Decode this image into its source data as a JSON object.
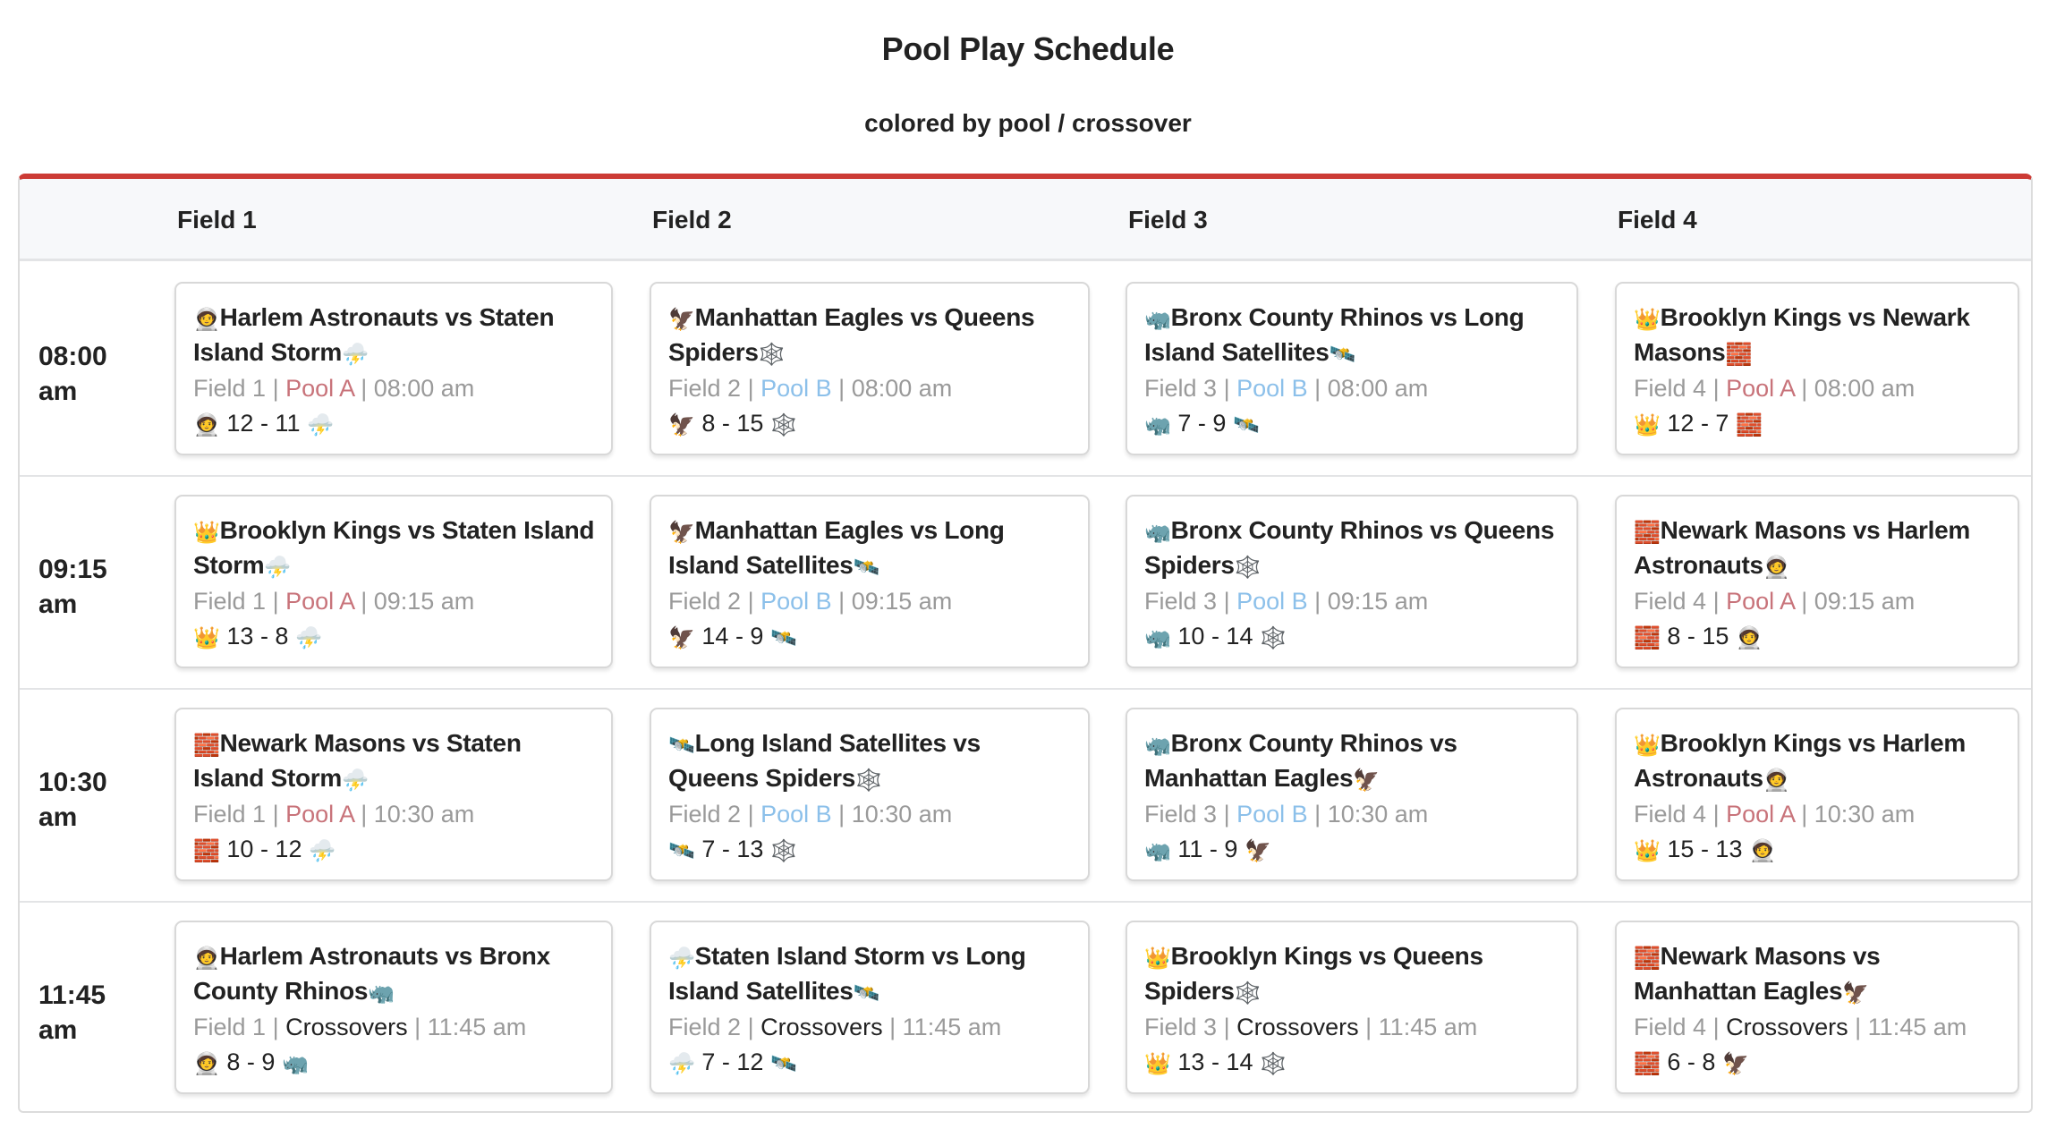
{
  "header": {
    "title": "Pool Play Schedule",
    "subtitle": "colored by pool / crossover"
  },
  "colors": {
    "accent_border": "#cc3b35",
    "pool_a": "#c8737a",
    "pool_b": "#8cc0ea",
    "crossovers": "#222222",
    "meta_gray": "#9a9a9a"
  },
  "teams": {
    "Harlem Astronauts": {
      "icon": "astronaut-icon",
      "glyph": "🧑‍🚀"
    },
    "Staten Island Storm": {
      "icon": "thunder-cloud-icon",
      "glyph": "⛈️"
    },
    "Manhattan Eagles": {
      "icon": "eagle-icon",
      "glyph": "🦅"
    },
    "Queens Spiders": {
      "icon": "spider-web-icon",
      "glyph": "🕸️"
    },
    "Bronx County Rhinos": {
      "icon": "rhino-icon",
      "glyph": "🦏"
    },
    "Long Island Satellites": {
      "icon": "satellite-icon",
      "glyph": "🛰️"
    },
    "Brooklyn Kings": {
      "icon": "crown-icon",
      "glyph": "👑"
    },
    "Newark Masons": {
      "icon": "brick-icon",
      "glyph": "🧱"
    }
  },
  "fields": [
    "Field 1",
    "Field 2",
    "Field 3",
    "Field 4"
  ],
  "separator": "|",
  "slots": [
    {
      "time_line1": "08:00",
      "time_line2": "am",
      "games": [
        {
          "home": "Harlem Astronauts",
          "away": "Staten Island Storm",
          "field": "Field 1",
          "pool": "Pool A",
          "pool_type": "a",
          "time": "08:00 am",
          "score": "12 - 11"
        },
        {
          "home": "Manhattan Eagles",
          "away": "Queens Spiders",
          "field": "Field 2",
          "pool": "Pool B",
          "pool_type": "b",
          "time": "08:00 am",
          "score": "8 - 15"
        },
        {
          "home": "Bronx County Rhinos",
          "away": "Long Island Satellites",
          "field": "Field 3",
          "pool": "Pool B",
          "pool_type": "b",
          "time": "08:00 am",
          "score": "7 - 9"
        },
        {
          "home": "Brooklyn Kings",
          "away": "Newark Masons",
          "field": "Field 4",
          "pool": "Pool A",
          "pool_type": "a",
          "time": "08:00 am",
          "score": "12 - 7"
        }
      ]
    },
    {
      "time_line1": "09:15",
      "time_line2": "am",
      "games": [
        {
          "home": "Brooklyn Kings",
          "away": "Staten Island Storm",
          "field": "Field 1",
          "pool": "Pool A",
          "pool_type": "a",
          "time": "09:15 am",
          "score": "13 - 8"
        },
        {
          "home": "Manhattan Eagles",
          "away": "Long Island Satellites",
          "field": "Field 2",
          "pool": "Pool B",
          "pool_type": "b",
          "time": "09:15 am",
          "score": "14 - 9"
        },
        {
          "home": "Bronx County Rhinos",
          "away": "Queens Spiders",
          "field": "Field 3",
          "pool": "Pool B",
          "pool_type": "b",
          "time": "09:15 am",
          "score": "10 - 14"
        },
        {
          "home": "Newark Masons",
          "away": "Harlem Astronauts",
          "field": "Field 4",
          "pool": "Pool A",
          "pool_type": "a",
          "time": "09:15 am",
          "score": "8 - 15"
        }
      ]
    },
    {
      "time_line1": "10:30",
      "time_line2": "am",
      "games": [
        {
          "home": "Newark Masons",
          "away": "Staten Island Storm",
          "field": "Field 1",
          "pool": "Pool A",
          "pool_type": "a",
          "time": "10:30 am",
          "score": "10 - 12"
        },
        {
          "home": "Long Island Satellites",
          "away": "Queens Spiders",
          "field": "Field 2",
          "pool": "Pool B",
          "pool_type": "b",
          "time": "10:30 am",
          "score": "7 - 13"
        },
        {
          "home": "Bronx County Rhinos",
          "away": "Manhattan Eagles",
          "field": "Field 3",
          "pool": "Pool B",
          "pool_type": "b",
          "time": "10:30 am",
          "score": "11 - 9"
        },
        {
          "home": "Brooklyn Kings",
          "away": "Harlem Astronauts",
          "field": "Field 4",
          "pool": "Pool A",
          "pool_type": "a",
          "time": "10:30 am",
          "score": "15 - 13"
        }
      ]
    },
    {
      "time_line1": "11:45",
      "time_line2": "am",
      "games": [
        {
          "home": "Harlem Astronauts",
          "away": "Bronx County Rhinos",
          "field": "Field 1",
          "pool": "Crossovers",
          "pool_type": "crossover",
          "time": "11:45 am",
          "score": "8 - 9"
        },
        {
          "home": "Staten Island Storm",
          "away": "Long Island Satellites",
          "field": "Field 2",
          "pool": "Crossovers",
          "pool_type": "crossover",
          "time": "11:45 am",
          "score": "7 - 12"
        },
        {
          "home": "Brooklyn Kings",
          "away": "Queens Spiders",
          "field": "Field 3",
          "pool": "Crossovers",
          "pool_type": "crossover",
          "time": "11:45 am",
          "score": "13 - 14"
        },
        {
          "home": "Newark Masons",
          "away": "Manhattan Eagles",
          "field": "Field 4",
          "pool": "Crossovers",
          "pool_type": "crossover",
          "time": "11:45 am",
          "score": "6 - 8"
        }
      ]
    }
  ]
}
